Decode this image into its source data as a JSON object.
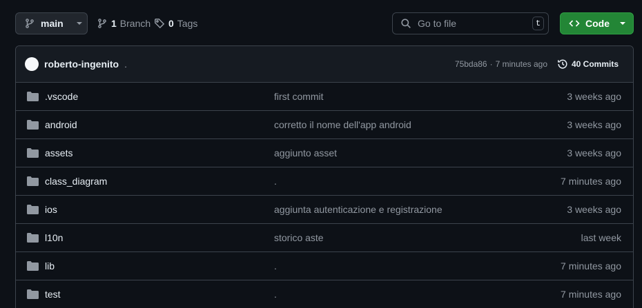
{
  "toolbar": {
    "branch_label": "main",
    "branches_count": "1",
    "branches_label": "Branch",
    "tags_count": "0",
    "tags_label": "Tags",
    "search_placeholder": "Go to file",
    "search_shortcut": "t",
    "code_label": "Code"
  },
  "commit": {
    "author": "roberto-ingenito",
    "message": ".",
    "sha": "75bda86",
    "separator": "·",
    "time": "7 minutes ago",
    "commits_label": "40 Commits"
  },
  "files": [
    {
      "name": ".vscode",
      "message": "first commit",
      "age": "3 weeks ago"
    },
    {
      "name": "android",
      "message": "corretto il nome dell'app android",
      "age": "3 weeks ago"
    },
    {
      "name": "assets",
      "message": "aggiunto asset",
      "age": "3 weeks ago"
    },
    {
      "name": "class_diagram",
      "message": ".",
      "age": "7 minutes ago"
    },
    {
      "name": "ios",
      "message": "aggiunta autenticazione e registrazione",
      "age": "3 weeks ago"
    },
    {
      "name": "l10n",
      "message": "storico aste",
      "age": "last week"
    },
    {
      "name": "lib",
      "message": ".",
      "age": "7 minutes ago"
    },
    {
      "name": "test",
      "message": ".",
      "age": "7 minutes ago"
    }
  ],
  "colors": {
    "background": "#0d1117",
    "accent_green": "#238636",
    "muted_text": "#9198a1",
    "folder_icon": "#9198a1"
  },
  "icons": {
    "branch": "git-branch-icon",
    "tag": "tag-icon",
    "search": "search-icon",
    "code": "code-icon",
    "history": "history-icon",
    "folder": "folder-icon"
  }
}
